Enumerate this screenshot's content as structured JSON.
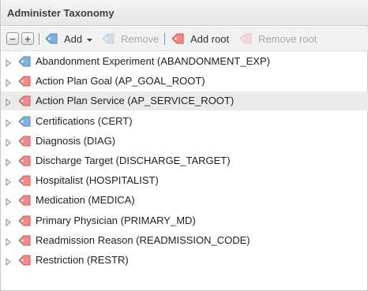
{
  "title": "Administer Taxonomy",
  "toolbar": {
    "collapse_symbol": "−",
    "expand_symbol": "+",
    "add_label": "Add",
    "remove_label": "Remove",
    "add_root_label": "Add root",
    "remove_root_label": "Remove root"
  },
  "colors": {
    "tag_blue": "#7fb2e0",
    "tag_red": "#f08a8a",
    "separator": "#6f9fd0"
  },
  "tree": {
    "selected_index": 2,
    "items": [
      {
        "label": "Abandonment Experiment (ABANDONMENT_EXP)",
        "tag": "blue"
      },
      {
        "label": "Action Plan Goal (AP_GOAL_ROOT)",
        "tag": "red"
      },
      {
        "label": "Action Plan Service (AP_SERVICE_ROOT)",
        "tag": "red"
      },
      {
        "label": "Certifications (CERT)",
        "tag": "blue"
      },
      {
        "label": "Diagnosis (DIAG)",
        "tag": "red"
      },
      {
        "label": "Discharge Target (DISCHARGE_TARGET)",
        "tag": "red"
      },
      {
        "label": "Hospitalist (HOSPITALIST)",
        "tag": "red"
      },
      {
        "label": "Medication (MEDICA)",
        "tag": "red"
      },
      {
        "label": "Primary Physician (PRIMARY_MD)",
        "tag": "red"
      },
      {
        "label": "Readmission Reason (READMISSION_CODE)",
        "tag": "red"
      },
      {
        "label": "Restriction (RESTR)",
        "tag": "red"
      }
    ]
  }
}
